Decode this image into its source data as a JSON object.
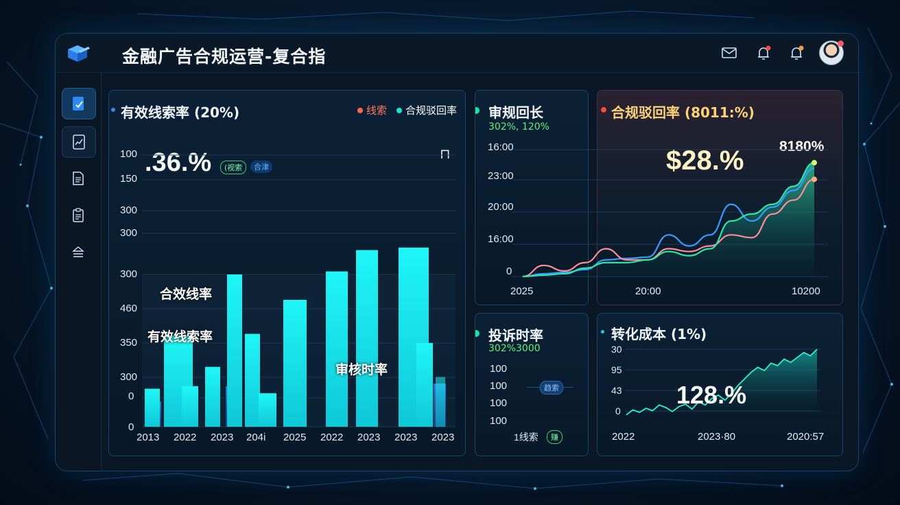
{
  "header": {
    "title": "金融广告合规运营-复合指"
  },
  "colors": {
    "cyan": "#18f0f0",
    "blue": "#2f7fe8",
    "green": "#2ee6a6",
    "pink": "#ff8c9a",
    "accent_red": "#ff5a4a"
  },
  "icons": {
    "logo": "cube-logo-icon",
    "mail": "mail-icon",
    "bell": "bell-icon",
    "avatar": "avatar"
  },
  "sidebar": {
    "items": [
      {
        "icon": "edit-document-icon"
      },
      {
        "icon": "chart-document-icon"
      },
      {
        "icon": "document-icon"
      },
      {
        "icon": "clipboard-icon"
      },
      {
        "icon": "stack-icon"
      }
    ]
  },
  "panel_main": {
    "title": "有效线索率 (20%)",
    "legend": [
      "线索",
      "合规驳回率"
    ],
    "big_value": ".36.%",
    "pills": [
      "(视索",
      "合津"
    ],
    "corner_glyph": "⊓",
    "y_ticks": [
      "100",
      "150",
      "300",
      "300",
      "300",
      "460",
      "350",
      "300",
      "0",
      "0"
    ],
    "x_ticks": [
      "2013",
      "2022",
      "2023",
      "204i",
      "2025",
      "2022",
      "2023",
      "2023",
      "2023"
    ],
    "overlay_labels": [
      "合效线率",
      "有效线索率",
      "审核时率"
    ]
  },
  "panel_review": {
    "title": "审规回长",
    "subtitle": "302%, 120%",
    "y_ticks": [
      "16:00",
      "23:00",
      "20:00",
      "16:00",
      "0"
    ],
    "x_ticks": [
      "2025",
      "20:00"
    ]
  },
  "panel_reject": {
    "title": "合规驳回率 (8011:%)",
    "big_value": "$28.%",
    "peak_label": "8180%",
    "x_end": "10200"
  },
  "panel_complaint": {
    "title": "投诉时率",
    "subtitle": "302%3000",
    "rows": [
      "100",
      "100",
      "100",
      "100"
    ],
    "pill1": "趋索",
    "bottom_text": "1线索",
    "pill2": "赚"
  },
  "panel_cost": {
    "title": "转化成本 (1%)",
    "big_value": "128.%",
    "y_ticks": [
      "30",
      "95",
      "43",
      "0"
    ],
    "x_ticks": [
      "2022",
      "2023·80",
      "2020:57"
    ]
  },
  "chart_data": [
    {
      "type": "bar",
      "title": "有效线索率 (20%)",
      "categories": [
        "2013",
        "2022",
        "2023",
        "204i",
        "2025",
        "2022",
        "2023",
        "2023",
        "2023"
      ],
      "series": [
        {
          "name": "线索",
          "values": [
            15,
            85,
            55,
            135,
            148,
            190,
            205,
            210,
            98
          ]
        },
        {
          "name": "合规驳回率",
          "values": [
            35,
            33,
            17,
            56,
            0,
            0,
            105,
            180,
            60
          ]
        }
      ]
    },
    {
      "type": "line",
      "title": "审规回长 / 合规驳回率",
      "x": [
        0,
        1,
        2,
        3,
        4,
        5,
        6,
        7,
        8,
        9,
        10,
        11,
        12,
        13,
        14
      ],
      "series": [
        {
          "values": [
            0,
            2,
            3,
            5,
            12,
            13,
            14,
            30,
            22,
            30,
            52,
            40,
            50,
            62,
            78
          ]
        },
        {
          "values": [
            0,
            8,
            4,
            10,
            20,
            12,
            12,
            20,
            18,
            22,
            30,
            28,
            45,
            55,
            70
          ]
        },
        {
          "values": [
            0,
            1,
            2,
            6,
            10,
            10,
            12,
            18,
            15,
            20,
            40,
            45,
            52,
            65,
            82
          ]
        }
      ]
    },
    {
      "type": "area",
      "title": "转化成本 (1%)",
      "x": [
        0,
        1,
        2,
        3,
        4,
        5,
        6,
        7,
        8,
        9,
        10,
        11,
        12,
        13,
        14,
        15,
        16,
        17,
        18,
        19,
        20,
        21,
        22,
        23,
        24,
        25,
        26,
        27,
        28,
        29
      ],
      "values": [
        2,
        8,
        5,
        10,
        7,
        14,
        11,
        6,
        12,
        15,
        9,
        18,
        14,
        22,
        26,
        20,
        28,
        38,
        46,
        54,
        60,
        56,
        65,
        62,
        70,
        66,
        72,
        78,
        74,
        82
      ]
    }
  ]
}
